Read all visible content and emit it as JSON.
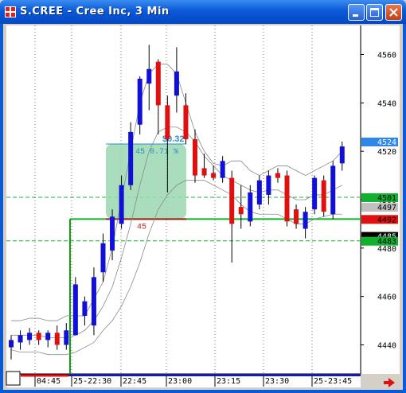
{
  "window": {
    "title": "S.CREE - Cree Inc, 3 Min",
    "minimize_label": "minimize",
    "maximize_label": "maximize",
    "close_label": "close"
  },
  "colors": {
    "up": "#1010d8",
    "down": "#e01010",
    "band": "#8a8a8a",
    "guide_green": "#10a010",
    "selection_fill": "#9ad7b0",
    "selection_text": "#2a8fc8",
    "axis_bg": "#ffffff"
  },
  "price_axis": {
    "ticks": [
      "4560",
      "4540",
      "4520",
      "4500",
      "4480",
      "4460",
      "4440"
    ],
    "markers": [
      {
        "label": "4524",
        "bg": "#2f88e8",
        "fg": "#ffffff"
      },
      {
        "label": "4501",
        "bg": "#10b030",
        "fg": "#000000"
      },
      {
        "label": "4497",
        "bg": "#c0c0c0",
        "fg": "#000000"
      },
      {
        "label": "4492",
        "bg": "#e01010",
        "fg": "#000000"
      },
      {
        "label": "4485",
        "bg": "#000000",
        "fg": "#ffffff"
      },
      {
        "label": "4483",
        "bg": "#10b030",
        "fg": "#000000"
      }
    ]
  },
  "time_axis": {
    "labels": [
      "04:45",
      "25-22:30",
      "22:45",
      "23:00",
      "23:15",
      "23:30",
      "25-23:45"
    ]
  },
  "selection": {
    "label_top": "$0.32",
    "label_pct": "45 0.71 %",
    "label_bottom": "45"
  },
  "chart_data": {
    "type": "candlestick",
    "ylim": [
      4428,
      4572
    ],
    "guides": [
      {
        "price": 4501,
        "style": "dashed",
        "color": "#10b030"
      },
      {
        "price": 4483,
        "style": "dashed",
        "color": "#10b030"
      },
      {
        "price": 4492,
        "style": "solid",
        "color": "#10b030"
      }
    ],
    "candles": [
      {
        "o": 4439,
        "c": 4442,
        "h": 4444,
        "l": 4434
      },
      {
        "o": 4441,
        "c": 4444,
        "h": 4446,
        "l": 4438
      },
      {
        "o": 4442,
        "c": 4445,
        "h": 4447,
        "l": 4440
      },
      {
        "o": 4445,
        "c": 4442,
        "h": 4446,
        "l": 4440
      },
      {
        "o": 4442,
        "c": 4445,
        "h": 4446,
        "l": 4439
      },
      {
        "o": 4445,
        "c": 4440,
        "h": 4448,
        "l": 4438
      },
      {
        "o": 4440,
        "c": 4446,
        "h": 4449,
        "l": 4438
      },
      {
        "o": 4444,
        "c": 4465,
        "h": 4468,
        "l": 4444
      },
      {
        "o": 4452,
        "c": 4458,
        "h": 4460,
        "l": 4448
      },
      {
        "o": 4448,
        "c": 4468,
        "h": 4472,
        "l": 4444
      },
      {
        "o": 4470,
        "c": 4482,
        "h": 4486,
        "l": 4466
      },
      {
        "o": 4479,
        "c": 4493,
        "h": 4496,
        "l": 4475
      },
      {
        "o": 4490,
        "c": 4506,
        "h": 4510,
        "l": 4488
      },
      {
        "o": 4506,
        "c": 4528,
        "h": 4532,
        "l": 4504
      },
      {
        "o": 4531,
        "c": 4550,
        "h": 4551,
        "l": 4527
      },
      {
        "o": 4548,
        "c": 4554,
        "h": 4564,
        "l": 4537
      },
      {
        "o": 4557,
        "c": 4539,
        "h": 4558,
        "l": 4527
      },
      {
        "o": 4539,
        "c": 4525,
        "h": 4543,
        "l": 4503
      },
      {
        "o": 4543,
        "c": 4553,
        "h": 4563,
        "l": 4536
      },
      {
        "o": 4539,
        "c": 4525,
        "h": 4544,
        "l": 4523
      },
      {
        "o": 4525,
        "c": 4510,
        "h": 4529,
        "l": 4507
      },
      {
        "o": 4513,
        "c": 4510,
        "h": 4519,
        "l": 4509
      },
      {
        "o": 4511,
        "c": 4509,
        "h": 4514,
        "l": 4508
      },
      {
        "o": 4509,
        "c": 4516,
        "h": 4518,
        "l": 4507
      },
      {
        "o": 4509,
        "c": 4490,
        "h": 4512,
        "l": 4474
      },
      {
        "o": 4497,
        "c": 4494,
        "h": 4506,
        "l": 4488
      },
      {
        "o": 4491,
        "c": 4503,
        "h": 4506,
        "l": 4489
      },
      {
        "o": 4498,
        "c": 4508,
        "h": 4510,
        "l": 4496
      },
      {
        "o": 4502,
        "c": 4510,
        "h": 4512,
        "l": 4498
      },
      {
        "o": 4511,
        "c": 4509,
        "h": 4513,
        "l": 4507
      },
      {
        "o": 4510,
        "c": 4491,
        "h": 4512,
        "l": 4489
      },
      {
        "o": 4496,
        "c": 4490,
        "h": 4498,
        "l": 4488
      },
      {
        "o": 4488,
        "c": 4495,
        "h": 4497,
        "l": 4484
      },
      {
        "o": 4496,
        "c": 4509,
        "h": 4510,
        "l": 4494
      },
      {
        "o": 4508,
        "c": 4495,
        "h": 4510,
        "l": 4493
      },
      {
        "o": 4494,
        "c": 4514,
        "h": 4516,
        "l": 4492
      },
      {
        "o": 4515,
        "c": 4522,
        "h": 4524,
        "l": 4512
      }
    ],
    "band_upper": [
      4450,
      4450,
      4451,
      4451,
      4450,
      4450,
      4452,
      4452,
      4452,
      4459,
      4466,
      4480,
      4500,
      4520,
      4540,
      4552,
      4556,
      4556,
      4552,
      4540,
      4528,
      4520,
      4515,
      4514,
      4516,
      4516,
      4512,
      4510,
      4512,
      4514,
      4514,
      4512,
      4510,
      4512,
      4514,
      4516,
      4520
    ],
    "band_mid": [
      4444,
      4444,
      4444,
      4444,
      4443,
      4443,
      4443,
      4444,
      4446,
      4450,
      4456,
      4464,
      4476,
      4490,
      4506,
      4520,
      4528,
      4530,
      4530,
      4528,
      4524,
      4518,
      4514,
      4510,
      4508,
      4506,
      4504,
      4503,
      4504,
      4504,
      4502,
      4500,
      4500,
      4502,
      4502,
      4504,
      4506
    ],
    "band_lower": [
      4438,
      4437,
      4437,
      4437,
      4436,
      4436,
      4436,
      4437,
      4439,
      4441,
      4446,
      4450,
      4456,
      4464,
      4474,
      4486,
      4496,
      4502,
      4506,
      4508,
      4508,
      4508,
      4506,
      4504,
      4502,
      4498,
      4495,
      4494,
      4494,
      4494,
      4492,
      4490,
      4490,
      4492,
      4493,
      4494,
      4494
    ]
  }
}
